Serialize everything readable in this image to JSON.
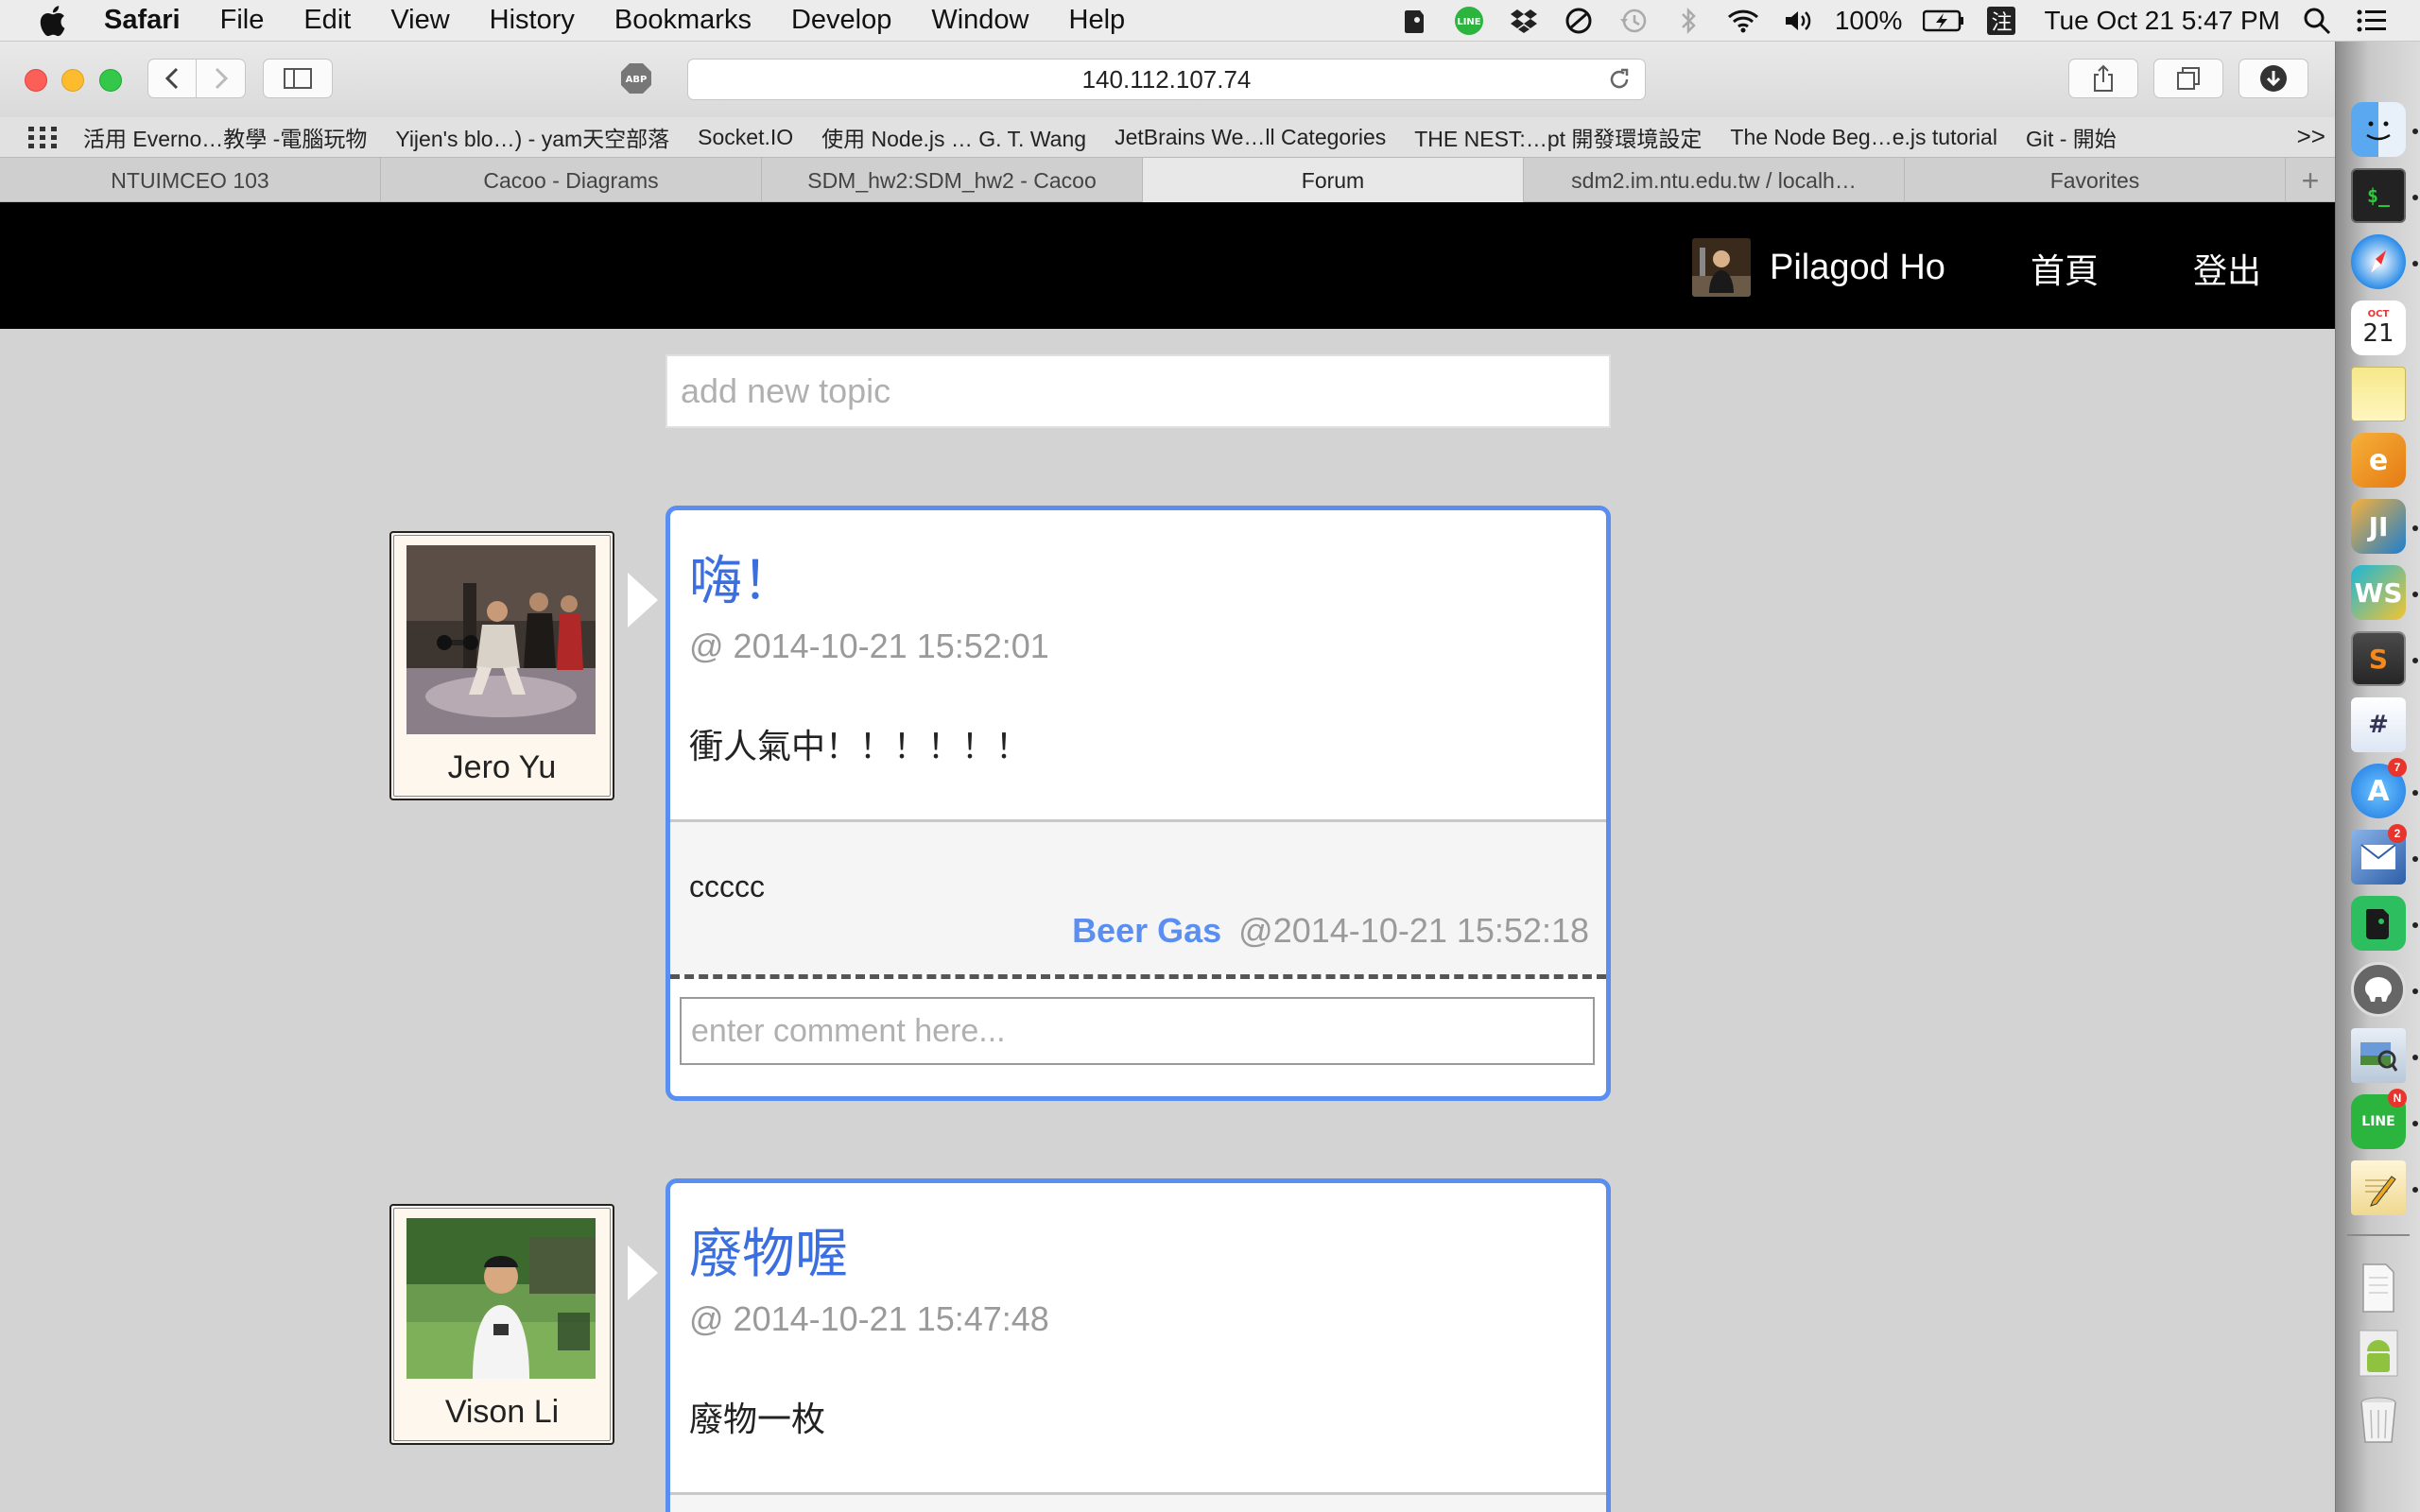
{
  "menubar": {
    "app_name": "Safari",
    "items": [
      "File",
      "Edit",
      "View",
      "History",
      "Bookmarks",
      "Develop",
      "Window",
      "Help"
    ],
    "status_icons": [
      "evernote-icon",
      "line-icon",
      "dropbox-icon",
      "donotdisturb-icon",
      "timemachine-icon",
      "bluetooth-icon",
      "wifi-icon",
      "volume-icon"
    ],
    "battery_text": "100%",
    "input_method": "注",
    "clock": "Tue Oct 21  5:47 PM"
  },
  "toolbar": {
    "address": "140.112.107.74",
    "adblock_label": "ABP"
  },
  "bookmarks": [
    "活用 Everno…教學 -電腦玩物",
    "Yijen's blo…) - yam天空部落",
    "Socket.IO",
    "使用 Node.js … G. T. Wang",
    "JetBrains We…ll Categories",
    "THE NEST:…pt 開發環境設定",
    "The Node Beg…e.js tutorial",
    "Git - 開始"
  ],
  "bookmarks_more": ">>",
  "tabs": [
    {
      "label": "NTUIMCEO 103",
      "active": false
    },
    {
      "label": "Cacoo - Diagrams",
      "active": false
    },
    {
      "label": "SDM_hw2:SDM_hw2 - Cacoo",
      "active": false
    },
    {
      "label": "Forum",
      "active": true
    },
    {
      "label": "sdm2.im.ntu.edu.tw / localh…",
      "active": false
    },
    {
      "label": "Favorites",
      "active": false
    }
  ],
  "tab_add": "+",
  "navbar": {
    "username": "Pilagod Ho",
    "home_label": "首頁",
    "logout_label": "登出"
  },
  "new_topic": {
    "placeholder": "add new topic"
  },
  "posts": [
    {
      "author": "Jero Yu",
      "title": "嗨！",
      "time": "@ 2014-10-21 15:52:01",
      "body": "衝人氣中！！！！！！",
      "comment": {
        "text": "ccccc",
        "by": "Beer Gas",
        "at": "@2014-10-21 15:52:18"
      },
      "comment_placeholder": "enter comment here..."
    },
    {
      "author": "Vison Li",
      "title": "廢物喔",
      "time": "@ 2014-10-21 15:47:48",
      "body": "廢物一枚"
    }
  ],
  "dock": {
    "apps": [
      "finder-icon",
      "terminal-icon",
      "safari-icon",
      "calendar-icon",
      "notes-icon",
      "instastats-icon",
      "intellij-icon",
      "webstorm-icon",
      "sublime-text-icon",
      "textwrangler-icon",
      "app-store-icon",
      "mail-icon",
      "evernote-icon",
      "sequel-pro-icon",
      "preview-icon",
      "line-icon",
      "textedit-icon",
      "document-icon",
      "android-icon",
      "trash-icon"
    ],
    "calendar_month": "OCT",
    "calendar_day": "21",
    "badge_app_store": "7",
    "badge_mail": "2",
    "badge_line": "N"
  },
  "colors": {
    "accent": "#5a8ef0",
    "title": "#3b6fe0",
    "page_bg": "#d3d3d3",
    "navbar_bg": "#000000"
  }
}
